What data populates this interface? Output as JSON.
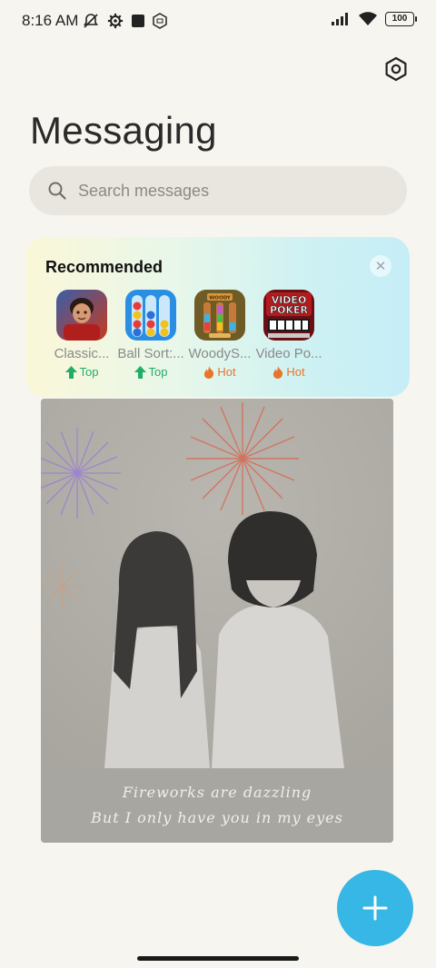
{
  "status_bar": {
    "time": "8:16 AM",
    "battery": "100",
    "icons_left": [
      "muted-notification-icon",
      "settings-gear-icon",
      "square-icon",
      "hexagon-badge-icon"
    ],
    "icons_right": [
      "signal-icon",
      "wifi-icon",
      "battery-icon"
    ]
  },
  "header": {
    "title": "Messaging",
    "settings_icon": "settings-icon"
  },
  "search": {
    "placeholder": "Search messages",
    "icon": "search-icon"
  },
  "recommended": {
    "title": "Recommended",
    "close_icon": "close-icon",
    "apps": [
      {
        "name": "Classic...",
        "badge": "Top",
        "badge_type": "top"
      },
      {
        "name": "Ball Sort:...",
        "badge": "Top",
        "badge_type": "top"
      },
      {
        "name": "WoodyS...",
        "badge": "Hot",
        "badge_type": "hot"
      },
      {
        "name": "Video Po...",
        "badge": "Hot",
        "badge_type": "hot"
      }
    ],
    "video_poker_icon_text": [
      "VIDEO",
      "POKER"
    ],
    "woody_icon_text": "WOODY"
  },
  "banner": {
    "line1": "Fireworks are dazzling",
    "line2": "But I only have you in my eyes"
  },
  "fab": {
    "icon": "plus-icon",
    "color": "#37b7e6"
  },
  "colors": {
    "background": "#f7f5ef",
    "top_badge": "#1fae67",
    "hot_badge": "#e8762a"
  }
}
